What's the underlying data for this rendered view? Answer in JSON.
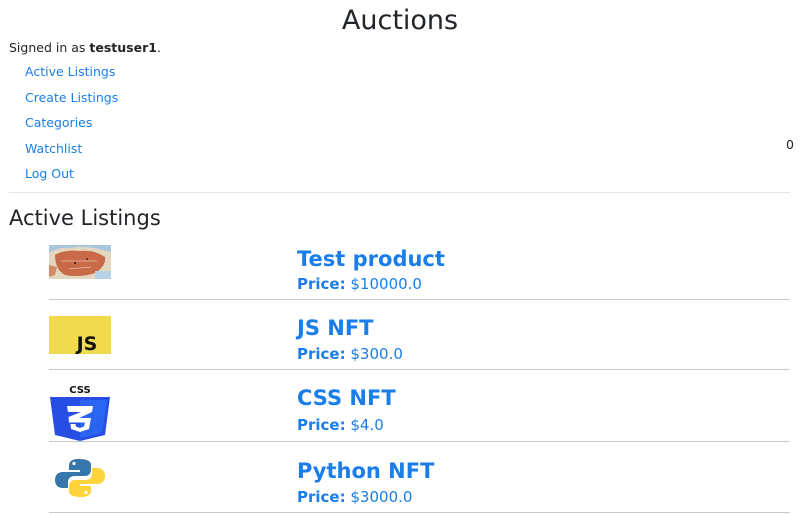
{
  "header": {
    "title": "Auctions"
  },
  "user": {
    "prefix": "Signed in as ",
    "username": "testuser1",
    "suffix": "."
  },
  "nav": [
    {
      "label": "Active Listings"
    },
    {
      "label": "Create Listings"
    },
    {
      "label": "Categories"
    },
    {
      "label": "Watchlist"
    },
    {
      "label": "Log Out"
    }
  ],
  "watchlist_count": "0",
  "section": {
    "title": "Active Listings"
  },
  "listings": [
    {
      "name": "Test product",
      "price_label": "Price:",
      "price": "$10000.0",
      "image": "map-thumbnail"
    },
    {
      "name": "JS NFT",
      "price_label": "Price:",
      "price": "$300.0",
      "image": "js-logo"
    },
    {
      "name": "CSS NFT",
      "price_label": "Price:",
      "price": "$4.0",
      "image": "css-logo"
    },
    {
      "name": "Python NFT",
      "price_label": "Price:",
      "price": "$3000.0",
      "image": "python-logo"
    }
  ],
  "colors": {
    "link": "#1a7ee8",
    "js_bg": "#f0db4f",
    "css_blue": "#2965f1",
    "python_blue": "#3776ab",
    "python_yellow": "#ffd43b"
  }
}
